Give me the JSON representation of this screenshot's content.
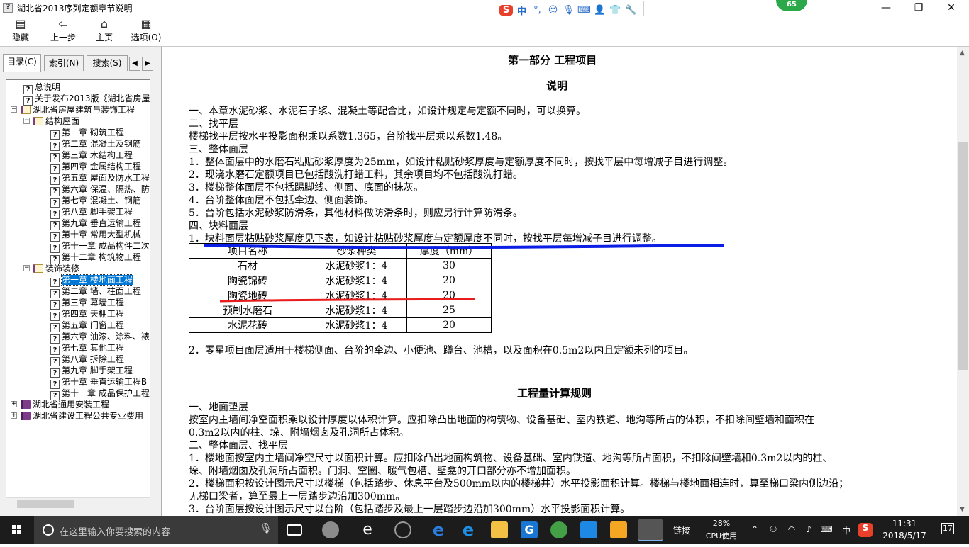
{
  "window": {
    "title": "湖北省2013序列定额章节说明",
    "controls": [
      "—",
      "❐",
      "✕"
    ]
  },
  "ime": {
    "mode": "中",
    "punct": "°,"
  },
  "badge": {
    "value": "65"
  },
  "toolbar": [
    {
      "label": "隐藏",
      "icon": "hide-icon"
    },
    {
      "label": "上一步",
      "icon": "back-arrow-icon"
    },
    {
      "label": "主页",
      "icon": "home-icon"
    },
    {
      "label": "选项(O)",
      "icon": "options-icon"
    }
  ],
  "tabs": [
    "目录(C)",
    "索引(N)",
    "搜索(S)"
  ],
  "tree": [
    {
      "label": "总说明",
      "icon": "help-page-icon"
    },
    {
      "label": "关于发布2013版《湖北省房屋",
      "icon": "help-page-icon"
    },
    {
      "label": "湖北省房屋建筑与装饰工程",
      "icon": "book-open-icon",
      "expander": "−"
    },
    {
      "label": "结构屋面",
      "icon": "book-open-icon",
      "expander": "−"
    },
    {
      "label": "第一章  砌筑工程",
      "icon": "help-page-icon"
    },
    {
      "label": "第二章  混凝土及钢筋",
      "icon": "help-page-icon"
    },
    {
      "label": "第三章  木结构工程",
      "icon": "help-page-icon"
    },
    {
      "label": "第四章  金属结构工程",
      "icon": "help-page-icon"
    },
    {
      "label": "第五章  屋面及防水工程",
      "icon": "help-page-icon"
    },
    {
      "label": "第六章  保温、隔热、防",
      "icon": "help-page-icon"
    },
    {
      "label": "第七章  混凝土、钢筋",
      "icon": "help-page-icon"
    },
    {
      "label": "第八章  脚手架工程",
      "icon": "help-page-icon"
    },
    {
      "label": "第九章  垂直运输工程",
      "icon": "help-page-icon"
    },
    {
      "label": "第十章  常用大型机械",
      "icon": "help-page-icon"
    },
    {
      "label": "第十一章  成品构件二次",
      "icon": "help-page-icon"
    },
    {
      "label": "第十二章  构筑物工程",
      "icon": "help-page-icon"
    },
    {
      "label": "装饰装修",
      "icon": "book-open-icon",
      "expander": "−"
    },
    {
      "label": "第一章  楼地面工程",
      "icon": "help-page-icon",
      "selected": true
    },
    {
      "label": "第二章  墙、柱面工程",
      "icon": "help-page-icon"
    },
    {
      "label": "第三章  幕墙工程",
      "icon": "help-page-icon"
    },
    {
      "label": "第四章  天棚工程",
      "icon": "help-page-icon"
    },
    {
      "label": "第五章  门窗工程",
      "icon": "help-page-icon"
    },
    {
      "label": "第六章  油漆、涂料、裱",
      "icon": "help-page-icon"
    },
    {
      "label": "第七章  其他工程",
      "icon": "help-page-icon"
    },
    {
      "label": "第八章  拆除工程",
      "icon": "help-page-icon"
    },
    {
      "label": "第九章  脚手架工程",
      "icon": "help-page-icon"
    },
    {
      "label": "第十章  垂直运输工程B",
      "icon": "help-page-icon"
    },
    {
      "label": "第十一章  成品保护工程",
      "icon": "help-page-icon"
    },
    {
      "label": "湖北省通用安装工程",
      "icon": "book-closed-icon",
      "expander": "+"
    },
    {
      "label": "湖北省建设工程公共专业费用",
      "icon": "book-closed-icon",
      "expander": "+"
    }
  ],
  "doc": {
    "part_title": "第一部分  工程项目",
    "section1": "说明",
    "lines1": [
      "一、本章水泥砂浆、水泥石子浆、混凝土等配合比，如设计规定与定额不同时，可以换算。",
      "二、找平层",
      "楼梯找平层按水平投影面积乘以系数1.365，台阶找平层乘以系数1.48。",
      "三、整体面层",
      "1．整体面层中的水磨石粘贴砂浆厚度为25mm，如设计粘贴砂浆厚度与定额厚度不同时，按找平层中每增减子目进行调整。",
      "2．现浇水磨石定额项目已包括酸洗打蜡工料，其余项目均不包括酸洗打蜡。",
      "3．楼梯整体面层不包括踢脚线、侧面、底面的抹灰。",
      "4．台阶整体面层不包括牵边、侧面装饰。",
      "5．台阶包括水泥砂浆防滑条，其他材料做防滑条时，则应另行计算防滑条。",
      "四、块料面层",
      "1．块料面层粘贴砂浆厚度见下表，如设计粘贴砂浆厚度与定额厚度不同时，按找平层每增减子目进行调整。"
    ],
    "table": {
      "headers": [
        "项目名称",
        "砂浆种类",
        "厚度（mm）"
      ],
      "rows": [
        [
          "石材",
          "水泥砂浆1：4",
          "30"
        ],
        [
          "陶瓷锦砖",
          "水泥砂浆1：4",
          "20"
        ],
        [
          "陶瓷地砖",
          "水泥砂浆1：4",
          "20"
        ],
        [
          "预制水磨石",
          "水泥砂浆1：4",
          "25"
        ],
        [
          "水泥花砖",
          "水泥砂浆1：4",
          "20"
        ]
      ]
    },
    "line_after_table": "2．零星项目面层适用于楼梯侧面、台阶的牵边、小便池、蹲台、池槽，以及面积在0.5m2以内且定额未列的项目。",
    "section2": "工程量计算规则",
    "lines2": [
      "一、地面垫层",
      "按室内主墙间净空面积乘以设计厚度以体积计算。应扣除凸出地面的构筑物、设备基础、室内铁道、地沟等所占的体积，不扣除间壁墙和面积在",
      "0.3m2以内的柱、垛、附墙烟囱及孔洞所占体积。",
      "二、整体面层、找平层",
      "1．楼地面按室内主墙间净空尺寸以面积计算。应扣除凸出地面构筑物、设备基础、室内铁道、地沟等所占面积，不扣除间壁墙和0.3m2以内的柱、",
      "垛、附墙烟囱及孔洞所占面积。门洞、空圈、暖气包槽、壁龛的开口部分亦不增加面积。",
      "2．楼梯面积按设计图示尺寸以楼梯（包括踏步、休息平台及500mm以内的楼梯井）水平投影面积计算。楼梯与楼地面相连时，算至梯口梁内侧边沿；",
      "无梯口梁者，算至最上一层踏步边沿加300mm。",
      "3．台阶面层按设计图示尺寸以台阶（包括踏步及最上一层踏步边沿加300mm）水平投影面积计算。"
    ]
  },
  "annotations": {
    "blue_underline_color": "#0a1ee6",
    "red_underline_color": "#e81c1c"
  },
  "taskbar": {
    "search_placeholder": "在这里输入你要搜索的内容",
    "link_label": "链接",
    "cpu_percent": "28%",
    "cpu_label": "CPU使用",
    "lang": "中",
    "time": "11:31",
    "date": "2018/5/17",
    "notifications": "17"
  }
}
